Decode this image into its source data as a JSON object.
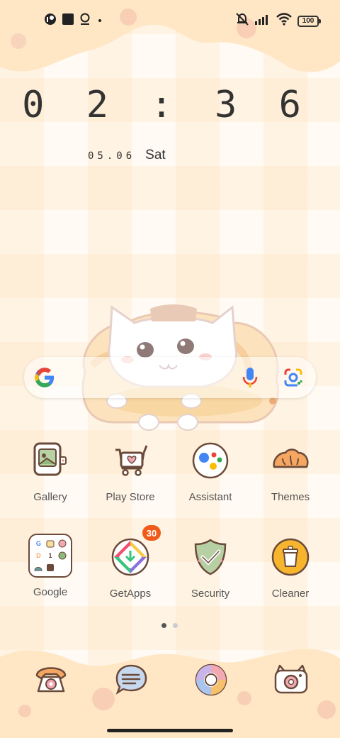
{
  "status_bar": {
    "left_icons": [
      "theme-app-icon",
      "square-notification-icon",
      "assistant-notification-icon",
      "more-dot-icon"
    ],
    "right_icons": [
      "mute-icon",
      "signal-icon",
      "wifi-icon",
      "battery-icon"
    ],
    "battery": "100"
  },
  "clock": {
    "time": "0 2 : 3 6",
    "date": "05.06",
    "weekday": "Sat"
  },
  "search": {
    "icons": [
      "google-logo-icon",
      "microphone-icon",
      "google-lens-icon"
    ]
  },
  "apps": [
    {
      "label": "Gallery",
      "icon": "gallery-icon"
    },
    {
      "label": "Play Store",
      "icon": "play-store-icon"
    },
    {
      "label": "Assistant",
      "icon": "assistant-icon"
    },
    {
      "label": "Themes",
      "icon": "themes-icon"
    },
    {
      "label": "Google",
      "icon": "google-folder-icon"
    },
    {
      "label": "GetApps",
      "icon": "getapps-icon",
      "badge": "30"
    },
    {
      "label": "Security",
      "icon": "security-icon"
    },
    {
      "label": "Cleaner",
      "icon": "cleaner-icon"
    }
  ],
  "folder_icons": [
    "G",
    "",
    "",
    "D",
    "1",
    "",
    "",
    "",
    ""
  ],
  "page_indicator": {
    "pages": 2,
    "current": 1
  },
  "dock": [
    "phone-icon",
    "messages-icon",
    "browser-icon",
    "camera-icon"
  ],
  "colors": {
    "accent_orange": "#f05a1a",
    "wallpaper_peach": "#ffe8c8",
    "outline_brown": "#6b4a3a"
  }
}
